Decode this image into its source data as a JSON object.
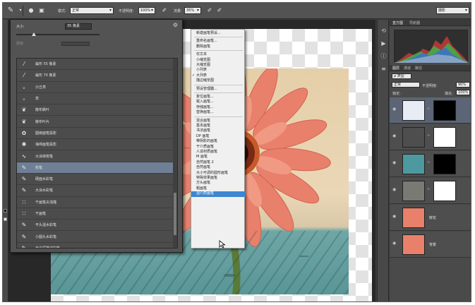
{
  "options_bar": {
    "mode_label": "模式:",
    "mode_value": "正常",
    "opacity_label": "不透明度:",
    "opacity_value": "100%",
    "flow_label": "流量:",
    "flow_value": "35%",
    "workspace_value": "摄影"
  },
  "brush_picker": {
    "size_label": "大小:",
    "size_value": "35 像素",
    "hardness_label": "硬度:",
    "items": [
      {
        "icon": "brush-tip-icon",
        "name": "扁形 55 像素"
      },
      {
        "icon": "brush-tip-icon",
        "name": "扁形 70 像素"
      },
      {
        "icon": "brush-tip-icon",
        "name": "沙丘草"
      },
      {
        "icon": "brush-tip-icon",
        "name": "草"
      },
      {
        "icon": "brush-tip-icon",
        "name": "散布枫叶"
      },
      {
        "icon": "brush-tip-icon",
        "name": "散布叶片"
      },
      {
        "icon": "brush-tip-icon",
        "name": "圆扇面笔投影"
      },
      {
        "icon": "brush-tip-icon",
        "name": "海绵画笔投影"
      },
      {
        "icon": "brush-tip-icon",
        "name": "大涂抹炭笔"
      },
      {
        "icon": "brush-tip-icon",
        "name": "粉笔",
        "selected": true
      },
      {
        "icon": "brush-tip-icon",
        "name": "硬面水彩笔"
      },
      {
        "icon": "brush-tip-icon",
        "name": "大涂水彩笔"
      },
      {
        "icon": "brush-tip-icon",
        "name": "干画笔尖浅描"
      },
      {
        "icon": "brush-tip-icon",
        "name": "干画笔"
      },
      {
        "icon": "brush-tip-icon",
        "name": "平头湿水彩笔"
      },
      {
        "icon": "brush-tip-icon",
        "name": "小圆头水彩笔"
      },
      {
        "icon": "brush-tip-icon",
        "name": "干边深描油彩笔"
      }
    ]
  },
  "menu": {
    "groups": [
      [
        "新建画笔预设..."
      ],
      [
        "重命名画笔...",
        "删除画笔"
      ],
      [
        "仅文本",
        "小缩览图",
        "大缩览图",
        "小列表",
        "大列表",
        "描边缩览图"
      ],
      [
        "预设管理器..."
      ],
      [
        "复位画笔...",
        "载入画笔...",
        "存储画笔...",
        "替换画笔..."
      ],
      [
        "混合画笔",
        "基本画笔",
        "书法画笔",
        "DP 画笔",
        "带阴影的画笔",
        "干介质画笔",
        "人造材质画笔",
        "M 画笔",
        "自然画笔 2",
        "自然画笔",
        "大小可调的圆形画笔",
        "特殊效果画笔",
        "方头画笔",
        "粗画笔",
        "湿介质画笔"
      ]
    ],
    "checked_item": "大列表",
    "highlighted_item": "湿介质画笔"
  },
  "right_panel": {
    "hist_tabs": [
      "直方图",
      "导航器"
    ],
    "layer_tabs": [
      "图层",
      "通道",
      "路径"
    ],
    "kind_value": "ρ 类型",
    "blend_value": "正常",
    "opacity_label": "不透明度:",
    "opacity_value": "90%",
    "lock_label": "锁定:",
    "fill_label": "填充:",
    "fill_value": "100%",
    "layers": [
      {
        "name": "",
        "active": true
      },
      {
        "name": ""
      },
      {
        "name": ""
      },
      {
        "name": ""
      },
      {
        "name": "鲜花"
      },
      {
        "name": "背景"
      }
    ]
  },
  "colors": {
    "menu_highlight": "#3d86d1",
    "list_selected": "#6f7f95",
    "flower": "#e8806a"
  }
}
